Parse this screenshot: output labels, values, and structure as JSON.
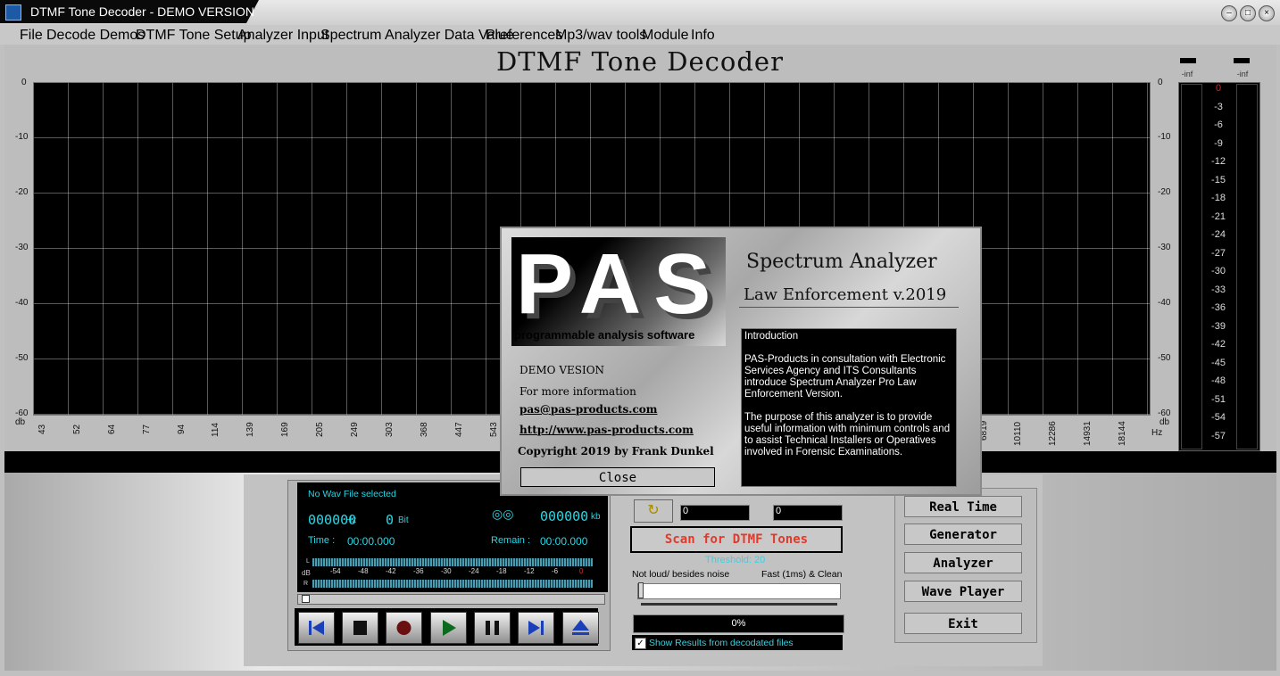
{
  "window": {
    "title": "DTMF Tone Decoder - DEMO VERSION",
    "buttons": [
      "minimize",
      "maximize",
      "close"
    ]
  },
  "menu": [
    {
      "label": "File"
    },
    {
      "label": "Decode Demos"
    },
    {
      "label": "DTMF Tone Setup"
    },
    {
      "label": "Analyzer Input"
    },
    {
      "label": "Spectrum Analyzer Data Value"
    },
    {
      "label": "Preferences"
    },
    {
      "label": "Mp3/wav tools"
    },
    {
      "label": "Module"
    },
    {
      "label": "Info"
    }
  ],
  "main": {
    "title": "DTMF Tone Decoder",
    "y_axis_left": [
      "0",
      "-10",
      "-20",
      "-30",
      "-40",
      "-50",
      "-60"
    ],
    "y_axis_right": [
      "0",
      "-10",
      "-20",
      "-30",
      "-40",
      "-50",
      "-60"
    ],
    "y_unit": "db",
    "x_ticks": [
      "43",
      "52",
      "64",
      "77",
      "94",
      "114",
      "139",
      "169",
      "205",
      "249",
      "303",
      "368",
      "447",
      "543",
      "6819",
      "10110",
      "12286",
      "14931",
      "18144"
    ],
    "x_unit": "Hz"
  },
  "meter": {
    "left_label": "-inf",
    "right_label": "-inf",
    "scale": [
      "0",
      "-3",
      "-6",
      "-9",
      "-12",
      "-15",
      "-18",
      "-21",
      "-24",
      "-27",
      "-30",
      "-33",
      "-36",
      "-39",
      "-42",
      "-45",
      "-48",
      "-51",
      "-54",
      "-57"
    ],
    "zero_color": "#e02020"
  },
  "player": {
    "file_status": "No Wav File selected",
    "hz": "000000",
    "hz_unit": "Hz",
    "bit": "0",
    "bit_unit": "Bit",
    "kb": "000000",
    "kb_unit": "kb",
    "time_label": "Time :",
    "time_value": "00:00.000",
    "remain_label": "Remain :",
    "remain_value": "00:00.000",
    "db_label": "dB",
    "l_label": "L",
    "r_label": "R",
    "db_scale": [
      "-54",
      "-48",
      "-42",
      "-36",
      "-30",
      "-24",
      "-18",
      "-12",
      "-6",
      "0"
    ],
    "buttons": [
      "skip-back",
      "stop",
      "record",
      "play",
      "pause",
      "skip-forward",
      "eject"
    ]
  },
  "scan": {
    "field1": "0",
    "field2": "0",
    "button": "Scan for DTMF Tones",
    "threshold": "Threshold: 20",
    "slider_left": "Not loud/ besides noise",
    "slider_right": "Fast (1ms) & Clean",
    "progress": "0%",
    "progress_value": 0,
    "checkbox_label": "Show Results from decodated files",
    "checkbox_checked": true
  },
  "nav": [
    {
      "label": "Real Time"
    },
    {
      "label": "Generator"
    },
    {
      "label": "Analyzer"
    },
    {
      "label": "Wave Player"
    },
    {
      "label": "Exit"
    }
  ],
  "dialog": {
    "logo": "PAS",
    "logo_sub": "programmable analysis software",
    "product": "Spectrum Analyzer",
    "edition": "Law Enforcement v.2019",
    "demo": "DEMO VESION",
    "more_info": "For more information",
    "email": "pas@pas-products.com",
    "url": "http://www.pas-products.com",
    "copyright": "Copyright 2019 by Frank Dunkel",
    "intro_title": "Introduction",
    "intro_p1": "PAS-Products in consultation with Electronic Services Agency and ITS Consultants introduce Spectrum Analyzer Pro Law Enforcement Version.",
    "intro_p2": "The purpose of this analyzer is to provide useful information with minimum controls and to assist Technical Installers or Operatives involved in Forensic Examinations.",
    "close": "Close"
  }
}
